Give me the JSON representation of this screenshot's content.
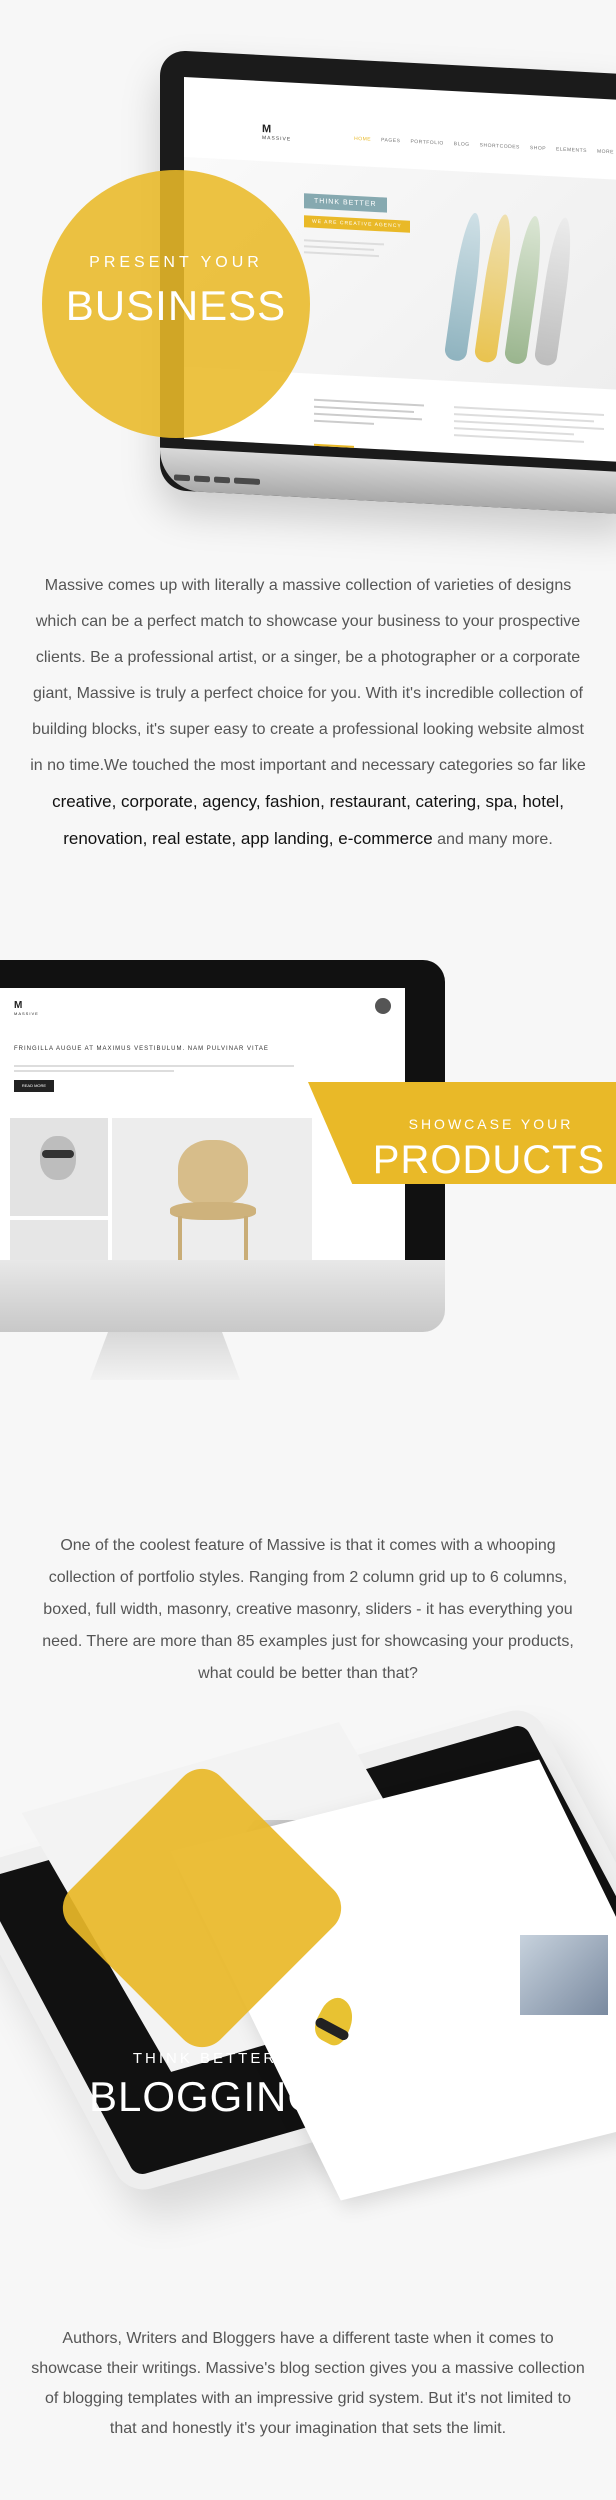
{
  "section1": {
    "small_heading": "PRESENT YOUR",
    "big_heading": "BUSINESS",
    "laptop_screen": {
      "logo": "M",
      "logo_word": "MASSIVE",
      "nav": [
        "HOME",
        "PAGES",
        "PORTFOLIO",
        "BLOG",
        "SHORTCODES",
        "SHOP",
        "ELEMENTS",
        "MORE"
      ],
      "tag": "THINK BETTER",
      "sub_tag": "WE ARE CREATIVE AGENCY",
      "button": "READ MORE"
    },
    "paragraph_plain": "Massive comes up with literally a massive collection of varieties of designs which can be a perfect match to showcase your business to your prospective clients. Be a professional artist, or a singer, be a photographer or a corporate giant, Massive is truly a perfect choice for you. With it's incredible collection of building blocks, it's super easy to create a professional looking website almost in no time.We touched the most important and necessary categories so far like",
    "paragraph_bold": "creative, corporate, agency, fashion, restaurant, catering, spa, hotel, renovation, real estate, app landing, e-commerce",
    "paragraph_end": "and many more."
  },
  "section2": {
    "small_heading": "SHOWCASE YOUR",
    "big_heading": "PRODUCTS",
    "imac_screen": {
      "logo": "M",
      "logo_word": "MASSIVE",
      "heading": "FRINGILLA AUGUE AT MAXIMUS VESTIBULUM. NAM PULVINAR VITAE",
      "button": "READ MORE"
    },
    "paragraph": "One of the coolest feature of Massive is that it comes with a whooping collection of portfolio styles. Ranging from 2 column grid up to 6 columns, boxed, full width, masonry, creative masonry, sliders - it has everything you need. There are more than 85 examples just for showcasing your products, what could be better than that?"
  },
  "section3": {
    "small_heading": "THINK BETTER",
    "big_heading": "BLOGGING",
    "paragraph": "Authors, Writers and Bloggers have a different taste when it comes to showcase their writings. Massive's blog section gives you a massive collection of blogging templates with an impressive grid system. But it's not limited to that and honestly it's your imagination that sets the limit."
  },
  "colors": {
    "accent": "#e9b928",
    "background": "#f7f7f7",
    "text": "#555555"
  }
}
